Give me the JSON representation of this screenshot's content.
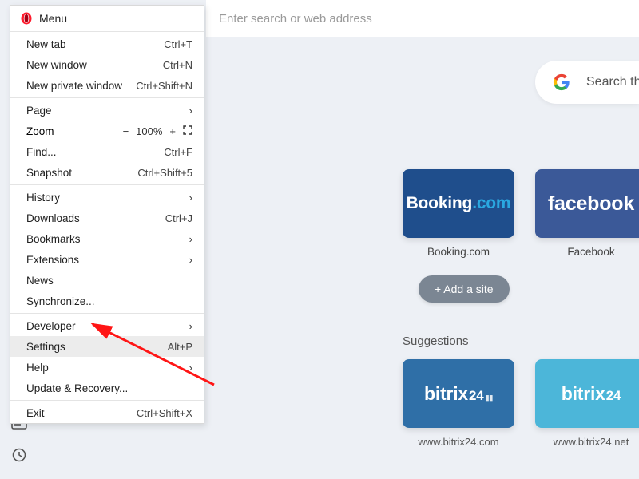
{
  "address_bar": {
    "placeholder": "Enter search or web address"
  },
  "menu": {
    "title": "Menu",
    "items": {
      "new_tab": {
        "label": "New tab",
        "shortcut": "Ctrl+T"
      },
      "new_window": {
        "label": "New window",
        "shortcut": "Ctrl+N"
      },
      "new_private": {
        "label": "New private window",
        "shortcut": "Ctrl+Shift+N"
      },
      "page": {
        "label": "Page"
      },
      "zoom": {
        "label": "Zoom",
        "value": "100%"
      },
      "find": {
        "label": "Find...",
        "shortcut": "Ctrl+F"
      },
      "snapshot": {
        "label": "Snapshot",
        "shortcut": "Ctrl+Shift+5"
      },
      "history": {
        "label": "History"
      },
      "downloads": {
        "label": "Downloads",
        "shortcut": "Ctrl+J"
      },
      "bookmarks": {
        "label": "Bookmarks"
      },
      "extensions": {
        "label": "Extensions"
      },
      "news": {
        "label": "News"
      },
      "synchronize": {
        "label": "Synchronize..."
      },
      "developer": {
        "label": "Developer"
      },
      "settings": {
        "label": "Settings",
        "shortcut": "Alt+P"
      },
      "help": {
        "label": "Help"
      },
      "update": {
        "label": "Update & Recovery..."
      },
      "exit": {
        "label": "Exit",
        "shortcut": "Ctrl+Shift+X"
      }
    }
  },
  "search_pill": {
    "placeholder": "Search the web"
  },
  "speed_dial": {
    "tiles": {
      "booking": {
        "brand_a": "Booking",
        "brand_b": ".com",
        "label": "Booking.com"
      },
      "facebook": {
        "brand": "facebook",
        "label": "Facebook"
      }
    },
    "add_button": "+ Add a site"
  },
  "suggestions": {
    "title": "Suggestions",
    "tiles": {
      "bitrix_com": {
        "brand": "bitrix",
        "n": "24",
        "url": "www.bitrix24.com"
      },
      "bitrix_net": {
        "brand": "bitrix",
        "n": "24",
        "url": "www.bitrix24.net"
      }
    }
  }
}
